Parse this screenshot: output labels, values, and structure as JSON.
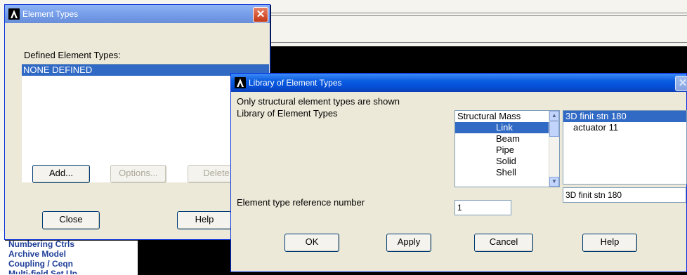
{
  "background": {
    "sidebar_items": [
      "Numbering Ctrls",
      "Archive Model",
      "Coupling / Ceqn",
      "Multi-field Set Up"
    ]
  },
  "element_types_dialog": {
    "title": "Element Types",
    "defined_label": "Defined Element Types:",
    "defined_items": [
      "NONE DEFINED"
    ],
    "buttons": {
      "add": "Add...",
      "options": "Options...",
      "delete": "Delete",
      "close": "Close",
      "help": "Help"
    }
  },
  "library_dialog": {
    "title": "Library of Element Types",
    "note": "Only structural element types are shown",
    "library_label": "Library of Element Types",
    "categories": [
      "Structural Mass",
      "Link",
      "Beam",
      "Pipe",
      "Solid",
      "Shell"
    ],
    "selected_category": "Link",
    "types": [
      "3D finit stn 180",
      "actuator  11"
    ],
    "selected_type": "3D finit stn 180",
    "selected_type_field": "3D finit stn 180",
    "ref_number_label": "Element type reference number",
    "ref_number_value": "1",
    "buttons": {
      "ok": "OK",
      "apply": "Apply",
      "cancel": "Cancel",
      "help": "Help"
    }
  }
}
